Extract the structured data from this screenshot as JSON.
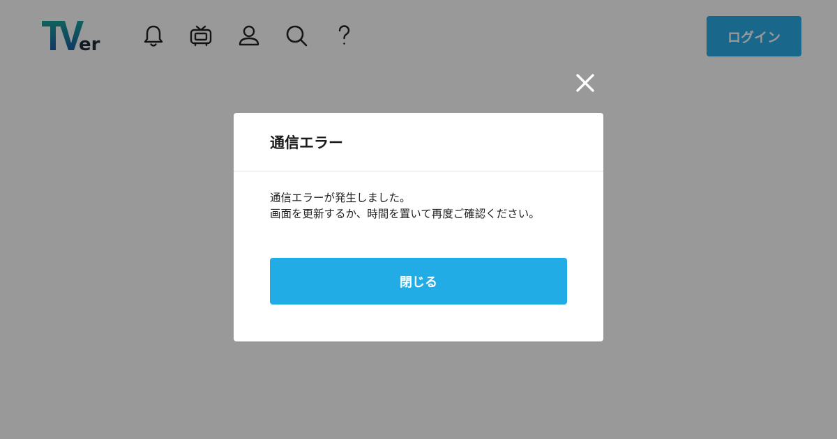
{
  "header": {
    "logo": {
      "text_t": "T",
      "text_v": "V",
      "text_er": "er"
    },
    "nav_icons": [
      "bell-icon",
      "tv-icon",
      "user-icon",
      "search-icon",
      "help-icon"
    ],
    "login_label": "ログイン"
  },
  "modal": {
    "title": "通信エラー",
    "message_line1": "通信エラーが発生しました。",
    "message_line2": "画面を更新するか、時間を置いて再度ご確認ください。",
    "close_button_label": "閉じる",
    "close_icon": "close-icon"
  },
  "colors": {
    "overlay": "rgba(0,0,0,0.4)",
    "accent": "#22ace6",
    "logo_teal": "#1aa39a",
    "logo_blue": "#1d5fa8",
    "logo_dark": "#1f2e3d"
  }
}
